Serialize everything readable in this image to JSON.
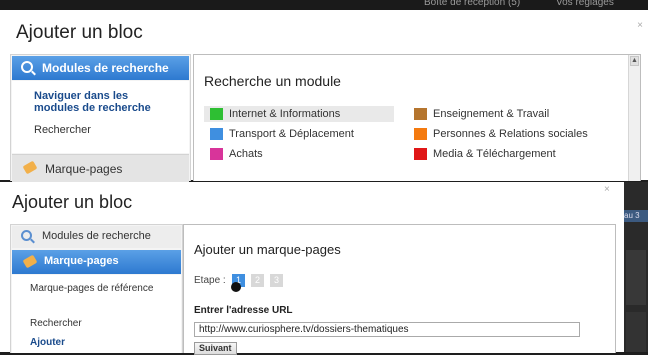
{
  "top": {
    "inbox_text": "Boîte de réception (5)",
    "settings_text": "Vos réglages"
  },
  "panel1": {
    "title": "Ajouter un bloc",
    "close": "×",
    "sidebar": {
      "active": "Modules de recherche",
      "nav_link": "Naviguer dans les modules de recherche",
      "search": "Rechercher",
      "bookmarks": "Marque-pages"
    },
    "content": {
      "heading": "Recherche un module",
      "categories": [
        {
          "label": "Internet & Informations",
          "color": "#2ebf33"
        },
        {
          "label": "Enseignement & Travail",
          "color": "#b5752e"
        },
        {
          "label": "Transport & Déplacement",
          "color": "#3f8fe0"
        },
        {
          "label": "Personnes & Relations sociales",
          "color": "#f47a0f"
        },
        {
          "label": "Achats",
          "color": "#d8349a"
        },
        {
          "label": "Media & Téléchargement",
          "color": "#e01717"
        }
      ]
    }
  },
  "panel2": {
    "title": "Ajouter un bloc",
    "close": "×",
    "sidebar": {
      "search_modules": "Modules de recherche",
      "active": "Marque-pages",
      "ref": "Marque-pages de référence",
      "search": "Rechercher",
      "add": "Ajouter"
    },
    "content": {
      "heading": "Ajouter un marque-pages",
      "step_label": "Etape :",
      "steps": [
        "1",
        "2",
        "3"
      ],
      "url_label": "Entrer l'adresse URL",
      "url_value": "http://www.curiosphere.tv/dossiers-thematiques",
      "submit": "Suivant"
    }
  },
  "right_strip": {
    "tab_text": "au 3"
  },
  "colors": {
    "accent_blue": "#2d79d0",
    "step_active": "#3f8fe0",
    "step_inactive": "#d8d8d8"
  }
}
